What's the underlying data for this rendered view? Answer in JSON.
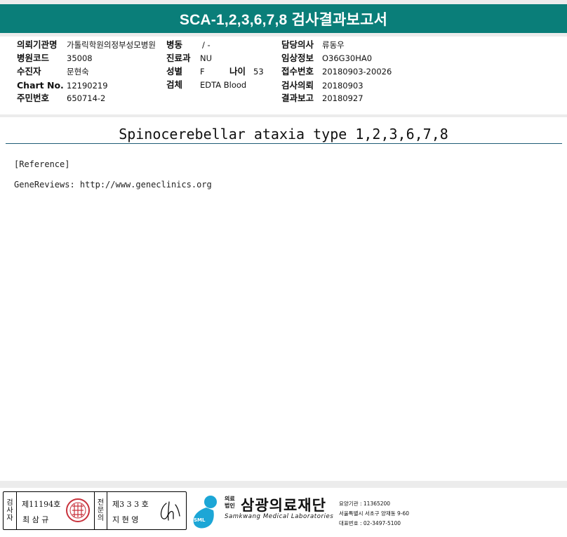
{
  "report": {
    "header_title": "SCA-1,2,3,6,7,8 검사결과보고서",
    "section_title": "Spinocerebellar ataxia type 1,2,3,6,7,8",
    "reference_label": "[Reference]",
    "reference_line": "GeneReviews: http://www.geneclinics.org"
  },
  "info": {
    "institution_label": "의뢰기관명",
    "institution_value": "가톨릭학원의정부성모병원",
    "ward_label": "병동",
    "ward_value": "/ -",
    "doctor_label": "담당의사",
    "doctor_value": "류동우",
    "hospital_code_label": "병원코드",
    "hospital_code_value": "35008",
    "department_label": "진료과",
    "department_value": "NU",
    "clinical_label": "임상정보",
    "clinical_value": "O36G30HA0",
    "patient_label": "수진자",
    "patient_value": "문현숙",
    "sex_label": "성별",
    "sex_value": "F",
    "age_label": "나이",
    "age_value": "53",
    "receipt_label": "접수번호",
    "receipt_value": "20180903-20026",
    "chart_label": "Chart No.",
    "chart_value": "12190219",
    "specimen_label": "검체",
    "specimen_value": "EDTA Blood",
    "request_label": "검사의뢰",
    "request_value": "20180903",
    "id_label": "주민번호",
    "id_value": "650714-2",
    "result_label": "결과보고",
    "result_value": "20180927"
  },
  "footer": {
    "tester_vertical": [
      "검",
      "사",
      "자"
    ],
    "tester_number": "제11194호",
    "tester_name": "최 삼 규",
    "specialist_vertical": [
      "전",
      "문",
      "의"
    ],
    "specialist_number": "제3 3 3 호",
    "specialist_name": "지 현 영",
    "logo_badge": "SML",
    "logo_tag_line1": "의료",
    "logo_tag_line2": "법인",
    "logo_name": "삼광의료재단",
    "logo_english": "Samkwang Medical Laboratories",
    "care_label": "요양기관 : 11365200",
    "address": "서울특별시 서초구 양재동 9-60",
    "phone": "대표번호 : 02-3497-5100"
  },
  "colors": {
    "header_bg": "#0a7e79",
    "rule": "#1f5d77",
    "logo_blue": "#1ca6d6",
    "seal_red": "#c8323c"
  }
}
